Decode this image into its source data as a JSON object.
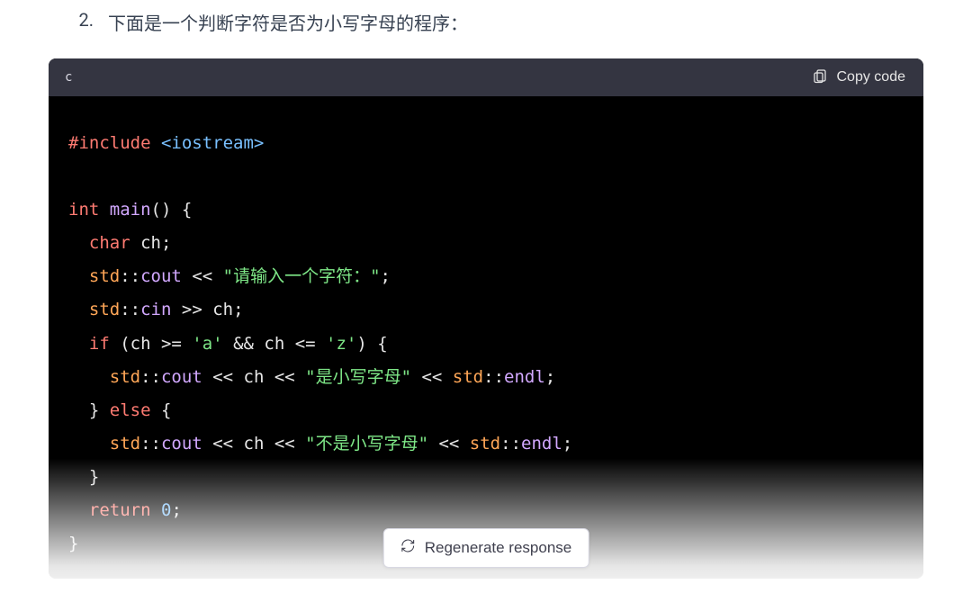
{
  "question": {
    "number": "2.",
    "text": "下面是一个判断字符是否为小写字母的程序："
  },
  "code_header": {
    "language": "c",
    "copy_label": "Copy code"
  },
  "code": {
    "tokens": [
      {
        "t": "#include",
        "c": "pp"
      },
      {
        "t": " "
      },
      {
        "t": "<iostream>",
        "c": "inc"
      },
      {
        "t": "\n"
      },
      {
        "t": "\n"
      },
      {
        "t": "int",
        "c": "ty"
      },
      {
        "t": " "
      },
      {
        "t": "main",
        "c": "fn"
      },
      {
        "t": "()",
        "c": "p"
      },
      {
        "t": " "
      },
      {
        "t": "{",
        "c": "br"
      },
      {
        "t": "\n"
      },
      {
        "t": "  "
      },
      {
        "t": "char",
        "c": "ty"
      },
      {
        "t": " ch;"
      },
      {
        "t": "\n"
      },
      {
        "t": "  "
      },
      {
        "t": "std",
        "c": "std"
      },
      {
        "t": "::"
      },
      {
        "t": "cout",
        "c": "id"
      },
      {
        "t": " << "
      },
      {
        "t": "\"请输入一个字符：\"",
        "c": "str"
      },
      {
        "t": ";"
      },
      {
        "t": "\n"
      },
      {
        "t": "  "
      },
      {
        "t": "std",
        "c": "std"
      },
      {
        "t": "::"
      },
      {
        "t": "cin",
        "c": "id"
      },
      {
        "t": " >> ch;"
      },
      {
        "t": "\n"
      },
      {
        "t": "  "
      },
      {
        "t": "if",
        "c": "kw"
      },
      {
        "t": " (ch >= "
      },
      {
        "t": "'a'",
        "c": "str"
      },
      {
        "t": " && ch <= "
      },
      {
        "t": "'z'",
        "c": "str"
      },
      {
        "t": ") "
      },
      {
        "t": "{",
        "c": "br"
      },
      {
        "t": "\n"
      },
      {
        "t": "    "
      },
      {
        "t": "std",
        "c": "std"
      },
      {
        "t": "::"
      },
      {
        "t": "cout",
        "c": "id"
      },
      {
        "t": " << ch << "
      },
      {
        "t": "\"是小写字母\"",
        "c": "str"
      },
      {
        "t": " << "
      },
      {
        "t": "std",
        "c": "std"
      },
      {
        "t": "::"
      },
      {
        "t": "endl",
        "c": "id"
      },
      {
        "t": ";"
      },
      {
        "t": "\n"
      },
      {
        "t": "  "
      },
      {
        "t": "}",
        "c": "br"
      },
      {
        "t": " "
      },
      {
        "t": "else",
        "c": "kw"
      },
      {
        "t": " "
      },
      {
        "t": "{",
        "c": "br"
      },
      {
        "t": "\n"
      },
      {
        "t": "    "
      },
      {
        "t": "std",
        "c": "std"
      },
      {
        "t": "::"
      },
      {
        "t": "cout",
        "c": "id"
      },
      {
        "t": " << ch << "
      },
      {
        "t": "\"不是小写字母\"",
        "c": "str"
      },
      {
        "t": " << "
      },
      {
        "t": "std",
        "c": "std"
      },
      {
        "t": "::"
      },
      {
        "t": "endl",
        "c": "id"
      },
      {
        "t": ";"
      },
      {
        "t": "\n"
      },
      {
        "t": "  "
      },
      {
        "t": "}",
        "c": "br"
      },
      {
        "t": "\n"
      },
      {
        "t": "  "
      },
      {
        "t": "return",
        "c": "kw"
      },
      {
        "t": " "
      },
      {
        "t": "0",
        "c": "num"
      },
      {
        "t": ";"
      },
      {
        "t": "\n"
      },
      {
        "t": "}",
        "c": "br"
      }
    ]
  },
  "regenerate_label": "Regenerate response"
}
